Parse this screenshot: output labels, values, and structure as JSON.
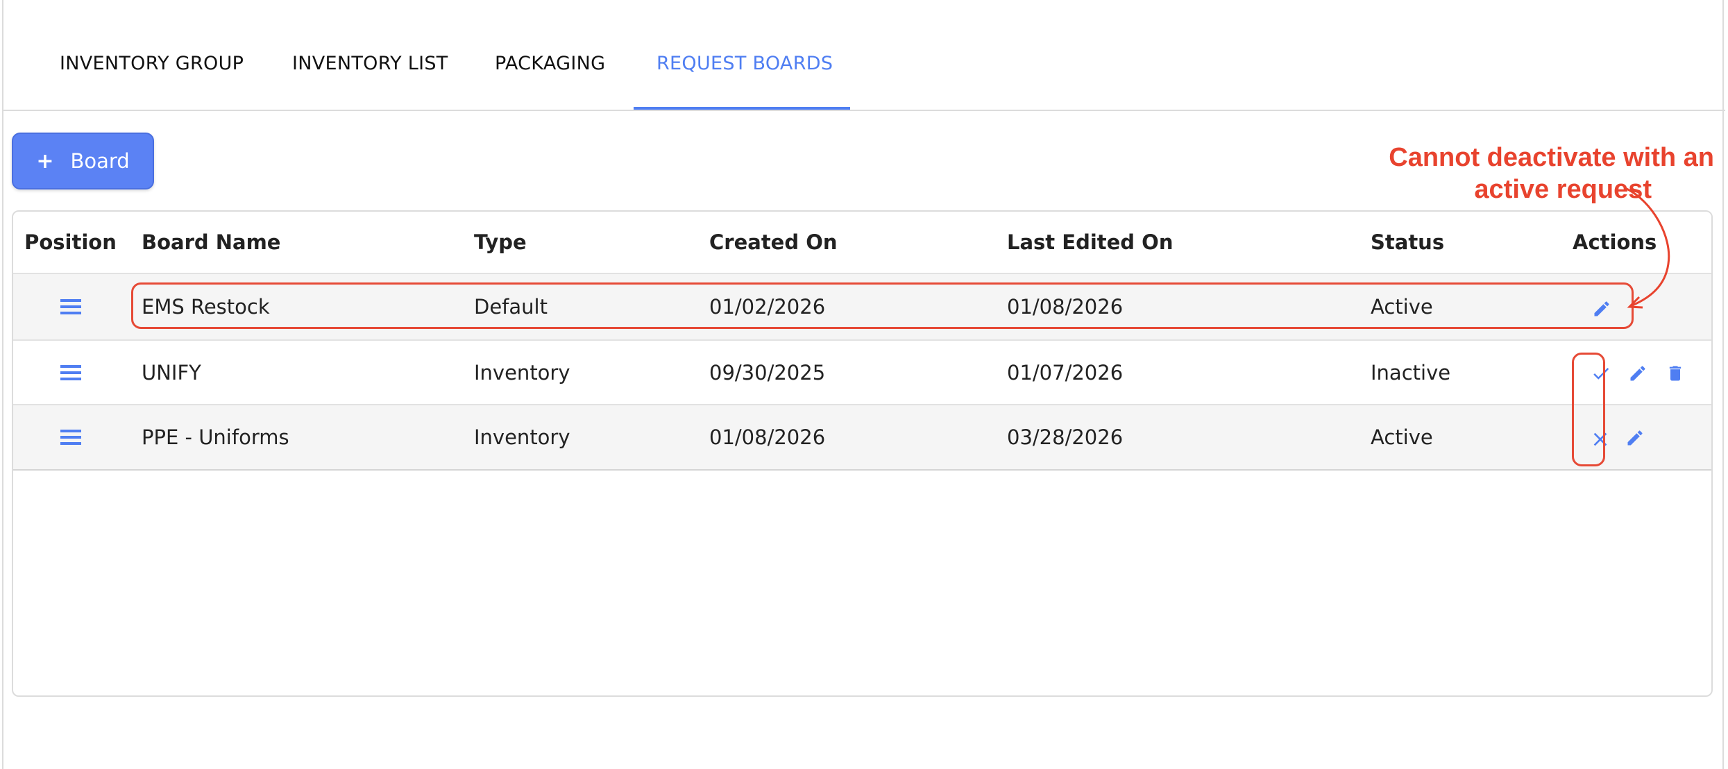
{
  "tabs": [
    {
      "label": "INVENTORY GROUP",
      "active": false
    },
    {
      "label": "INVENTORY LIST",
      "active": false
    },
    {
      "label": "PACKAGING",
      "active": false
    },
    {
      "label": "REQUEST BOARDS",
      "active": true
    }
  ],
  "add_button": {
    "label": "Board",
    "icon": "plus-icon"
  },
  "table": {
    "columns": [
      "Position",
      "Board Name",
      "Type",
      "Created On",
      "Last Edited On",
      "Status",
      "Actions"
    ],
    "rows": [
      {
        "name": "EMS Restock",
        "type": "Default",
        "created": "01/02/2026",
        "edited": "01/08/2026",
        "status": "Active",
        "actions": [
          "edit-icon"
        ]
      },
      {
        "name": "UNIFY",
        "type": "Inventory",
        "created": "09/30/2025",
        "edited": "01/07/2026",
        "status": "Inactive",
        "actions": [
          "check-icon",
          "edit-icon",
          "trash-icon"
        ]
      },
      {
        "name": "PPE - Uniforms",
        "type": "Inventory",
        "created": "01/08/2026",
        "edited": "03/28/2026",
        "status": "Active",
        "actions": [
          "close-icon",
          "edit-icon"
        ]
      }
    ]
  },
  "annotation": {
    "line1": "Cannot deactivate with an",
    "line2": "active request"
  },
  "colors": {
    "accent": "#4f7ef2",
    "button": "#5b82f4",
    "annotation": "#e8432e"
  }
}
